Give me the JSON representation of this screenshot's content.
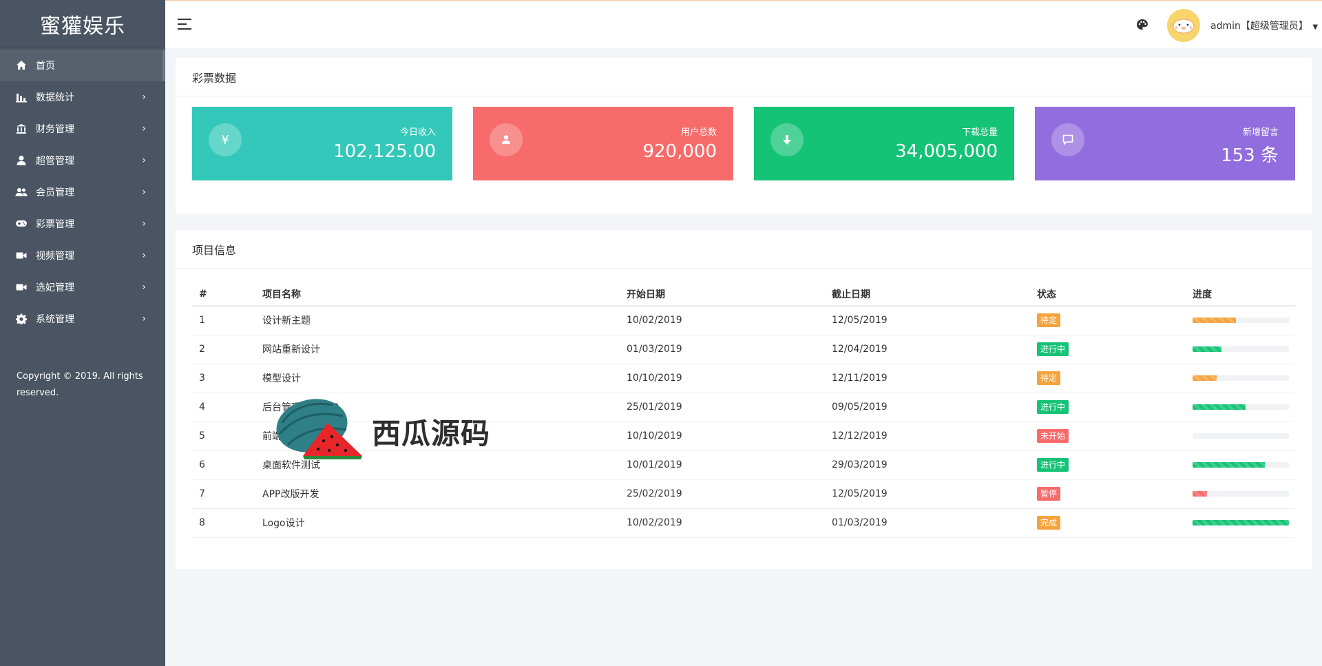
{
  "sidebar": {
    "brand": "蜜獾娱乐",
    "items": [
      {
        "label": "首页",
        "icon": "home-icon",
        "active": true
      },
      {
        "label": "数据统计",
        "icon": "bar-chart-icon"
      },
      {
        "label": "财务管理",
        "icon": "bank-icon"
      },
      {
        "label": "超管管理",
        "icon": "user-icon"
      },
      {
        "label": "会员管理",
        "icon": "users-icon"
      },
      {
        "label": "彩票管理",
        "icon": "gamepad-icon"
      },
      {
        "label": "视频管理",
        "icon": "video-icon"
      },
      {
        "label": "选妃管理",
        "icon": "video-icon"
      },
      {
        "label": "系统管理",
        "icon": "gear-icon"
      }
    ],
    "copyright": "Copyright © 2019. All rights reserved."
  },
  "topbar": {
    "user": "admin【超级管理员】"
  },
  "lottery": {
    "title": "彩票数据",
    "stats": [
      {
        "label": "今日收入",
        "value": "102,125.00",
        "color": "#33c8b9",
        "icon": "yen-icon",
        "glyph": "¥"
      },
      {
        "label": "用户总数",
        "value": "920,000",
        "color": "#f76b6b",
        "icon": "user-icon",
        "glyph": ""
      },
      {
        "label": "下载总量",
        "value": "34,005,000",
        "color": "#15c377",
        "icon": "download-icon",
        "glyph": ""
      },
      {
        "label": "新增留言",
        "value": "153 条",
        "color": "#926dde",
        "icon": "comment-icon",
        "glyph": ""
      }
    ]
  },
  "projects": {
    "title": "项目信息",
    "columns": [
      "#",
      "项目名称",
      "开始日期",
      "截止日期",
      "状态",
      "进度"
    ],
    "rows": [
      {
        "no": "1",
        "name": "设计新主题",
        "start": "10/02/2019",
        "end": "12/05/2019",
        "status": "待定",
        "status_color": "#f6a33f",
        "progress": 0.45,
        "bar_color": "#f6a33f"
      },
      {
        "no": "2",
        "name": "网站重新设计",
        "start": "01/03/2019",
        "end": "12/04/2019",
        "status": "进行中",
        "status_color": "#15c377",
        "progress": 0.3,
        "bar_color": "#15c377"
      },
      {
        "no": "3",
        "name": "模型设计",
        "start": "10/10/2019",
        "end": "12/11/2019",
        "status": "待定",
        "status_color": "#f6a33f",
        "progress": 0.25,
        "bar_color": "#f6a33f"
      },
      {
        "no": "4",
        "name": "后台管理系统APP",
        "start": "25/01/2019",
        "end": "09/05/2019",
        "status": "进行中",
        "status_color": "#15c377",
        "progress": 0.55,
        "bar_color": "#15c377"
      },
      {
        "no": "5",
        "name": "前端设计",
        "start": "10/10/2019",
        "end": "12/12/2019",
        "status": "未开始",
        "status_color": "#f76b6b",
        "progress": 0.0,
        "bar_color": "#15c377"
      },
      {
        "no": "6",
        "name": "桌面软件测试",
        "start": "10/01/2019",
        "end": "29/03/2019",
        "status": "进行中",
        "status_color": "#15c377",
        "progress": 0.75,
        "bar_color": "#15c377"
      },
      {
        "no": "7",
        "name": "APP改版开发",
        "start": "25/02/2019",
        "end": "12/05/2019",
        "status": "暂停",
        "status_color": "#f76b6b",
        "progress": 0.15,
        "bar_color": "#f76b6b"
      },
      {
        "no": "8",
        "name": "Logo设计",
        "start": "10/02/2019",
        "end": "01/03/2019",
        "status": "完成",
        "status_color": "#f6a33f",
        "progress": 1.0,
        "bar_color": "#15c377"
      }
    ]
  },
  "watermark": {
    "text": "西瓜源码"
  }
}
